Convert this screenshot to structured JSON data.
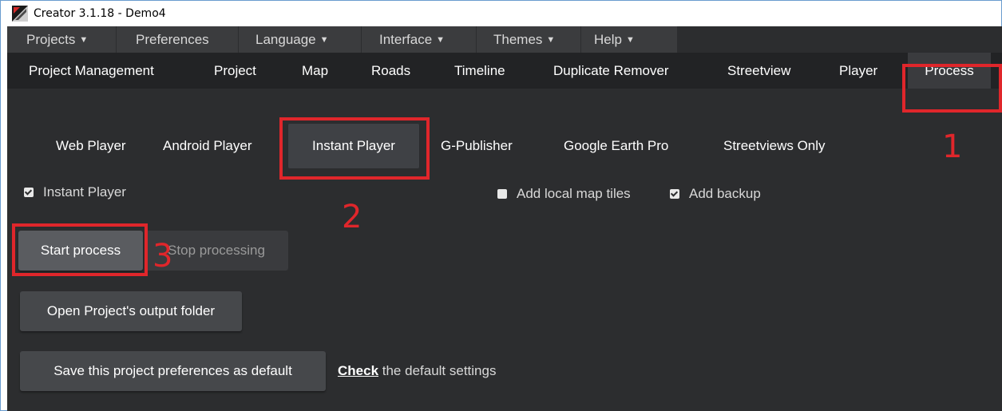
{
  "window": {
    "title": "Creator 3.1.18 - Demo4"
  },
  "menubar": {
    "items": [
      {
        "label": "Projects",
        "caret": "▼"
      },
      {
        "label": "Preferences",
        "caret": ""
      },
      {
        "label": "Language",
        "caret": "▼"
      },
      {
        "label": "Interface",
        "caret": "▼"
      },
      {
        "label": "Themes",
        "caret": "▼"
      },
      {
        "label": "Help",
        "caret": "▼"
      }
    ]
  },
  "navbar": {
    "items": [
      {
        "label": "Project Management"
      },
      {
        "label": "Project"
      },
      {
        "label": "Map"
      },
      {
        "label": "Roads"
      },
      {
        "label": "Timeline"
      },
      {
        "label": "Duplicate Remover"
      },
      {
        "label": "Streetview"
      },
      {
        "label": "Player"
      },
      {
        "label": "Process"
      }
    ],
    "active": "Process"
  },
  "subtabs": {
    "items": [
      {
        "label": "Web Player"
      },
      {
        "label": "Android Player"
      },
      {
        "label": "Instant Player"
      },
      {
        "label": "G-Publisher"
      },
      {
        "label": "Google Earth Pro"
      },
      {
        "label": "Streetviews Only"
      }
    ],
    "active": "Instant Player"
  },
  "options": {
    "instant_player": {
      "label": "Instant Player",
      "checked": true
    },
    "add_local_map_tiles": {
      "label": "Add local map tiles",
      "checked": false
    },
    "add_backup": {
      "label": "Add backup",
      "checked": true
    }
  },
  "actions": {
    "start_process": "Start process",
    "stop_processing": "Stop processing",
    "open_output_folder": "Open Project's output folder",
    "save_preferences_default": "Save this project preferences as default"
  },
  "defaults_link": {
    "link": "Check",
    "text": " the default settings"
  },
  "annotations": {
    "step1": "1",
    "step2": "2",
    "step3": "3",
    "color": "#e0262b"
  },
  "colors": {
    "app_bg": "#2c2d2f",
    "menubar_bg": "#3b3c3e",
    "navbar_bg": "#222325"
  }
}
